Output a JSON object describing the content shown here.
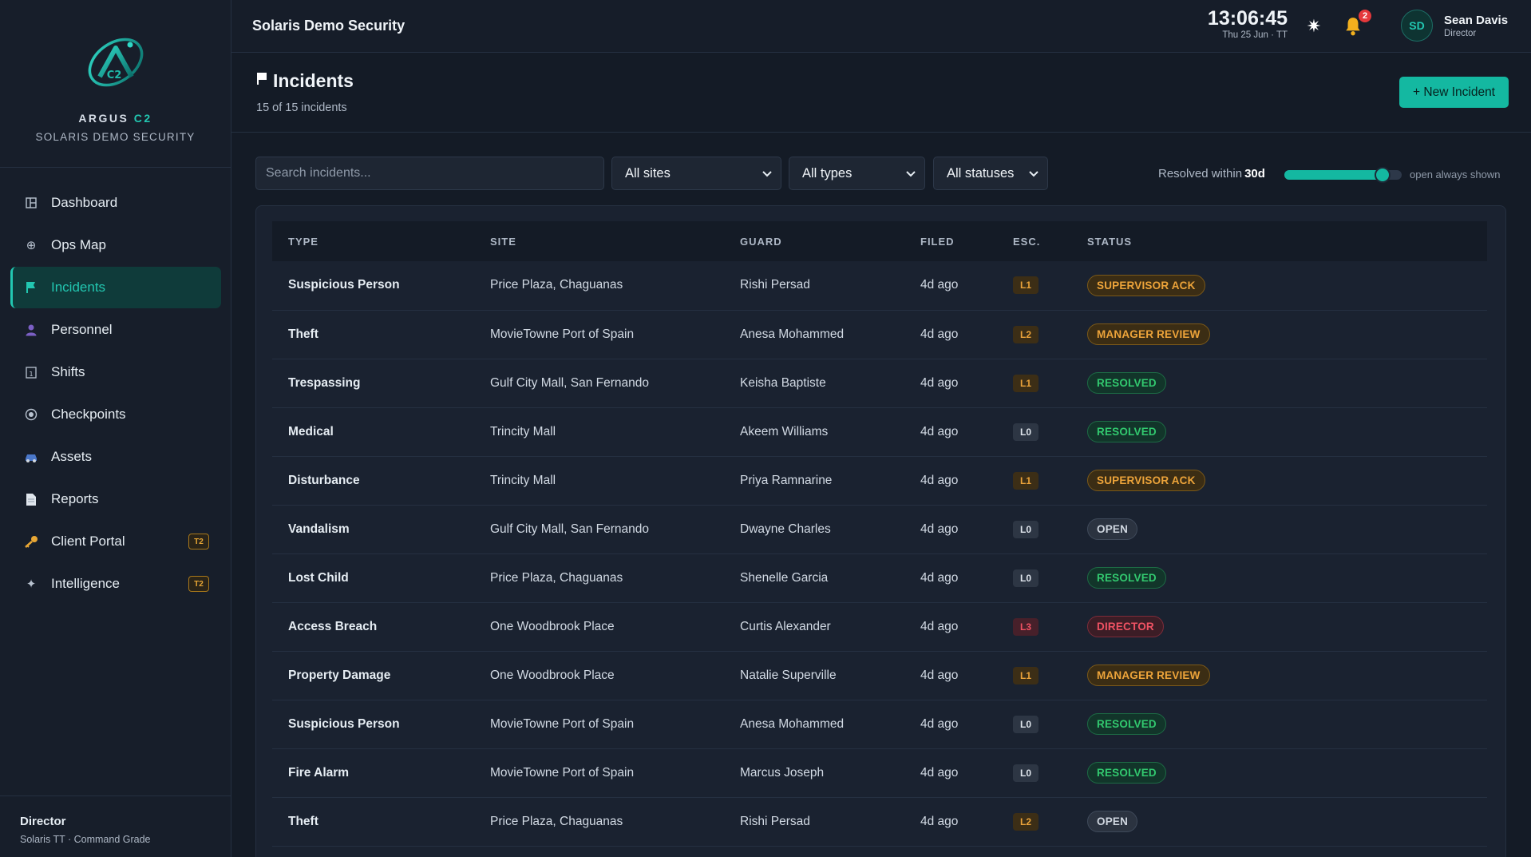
{
  "brand": {
    "name_prefix": "ARGUS ",
    "name_suffix": "C2",
    "org": "SOLARIS DEMO SECURITY",
    "logo_icon": "argus-c2-logo"
  },
  "sidebar": {
    "items": [
      {
        "label": "Dashboard",
        "icon": "dashboard-icon",
        "active": false
      },
      {
        "label": "Ops Map",
        "icon": "globe-icon",
        "active": false
      },
      {
        "label": "Incidents",
        "icon": "flag-icon",
        "active": true
      },
      {
        "label": "Personnel",
        "icon": "person-icon",
        "active": false
      },
      {
        "label": "Shifts",
        "icon": "calendar-icon",
        "active": false
      },
      {
        "label": "Checkpoints",
        "icon": "target-icon",
        "active": false
      },
      {
        "label": "Assets",
        "icon": "car-icon",
        "active": false
      },
      {
        "label": "Reports",
        "icon": "document-icon",
        "active": false
      },
      {
        "label": "Client Portal",
        "icon": "key-icon",
        "active": false,
        "tier": "T2"
      },
      {
        "label": "Intelligence",
        "icon": "sparkle-icon",
        "active": false,
        "tier": "T2"
      }
    ],
    "footer": {
      "role": "Director",
      "org": "Solaris TT · Command Grade"
    }
  },
  "topbar": {
    "title": "Solaris Demo Security",
    "time": "13:06:45",
    "date": "Thu 25 Jun · TT",
    "notifications_count": "2",
    "user": {
      "initials": "SD",
      "name": "Sean Davis",
      "role": "Director"
    }
  },
  "page": {
    "title": "Incidents",
    "count_text": "15 of 15 incidents",
    "new_button": "+ New Incident"
  },
  "filters": {
    "search_placeholder": "Search incidents...",
    "site": "All sites",
    "type": "All types",
    "status": "All statuses",
    "range_label": "Resolved within",
    "range_value": "30d",
    "range_fraction": 0.84,
    "range_note": "open always shown"
  },
  "table": {
    "columns": [
      "TYPE",
      "SITE",
      "GUARD",
      "FILED",
      "ESC.",
      "STATUS"
    ],
    "rows": [
      {
        "type": "Suspicious Person",
        "site": "Price Plaza, Chaguanas",
        "guard": "Rishi Persad",
        "filed": "4d ago",
        "esc": "L1",
        "status": "SUPERVISOR ACK"
      },
      {
        "type": "Theft",
        "site": "MovieTowne Port of Spain",
        "guard": "Anesa Mohammed",
        "filed": "4d ago",
        "esc": "L2",
        "status": "MANAGER REVIEW"
      },
      {
        "type": "Trespassing",
        "site": "Gulf City Mall, San Fernando",
        "guard": "Keisha Baptiste",
        "filed": "4d ago",
        "esc": "L1",
        "status": "RESOLVED"
      },
      {
        "type": "Medical",
        "site": "Trincity Mall",
        "guard": "Akeem Williams",
        "filed": "4d ago",
        "esc": "L0",
        "status": "RESOLVED"
      },
      {
        "type": "Disturbance",
        "site": "Trincity Mall",
        "guard": "Priya Ramnarine",
        "filed": "4d ago",
        "esc": "L1",
        "status": "SUPERVISOR ACK"
      },
      {
        "type": "Vandalism",
        "site": "Gulf City Mall, San Fernando",
        "guard": "Dwayne Charles",
        "filed": "4d ago",
        "esc": "L0",
        "status": "OPEN"
      },
      {
        "type": "Lost Child",
        "site": "Price Plaza, Chaguanas",
        "guard": "Shenelle Garcia",
        "filed": "4d ago",
        "esc": "L0",
        "status": "RESOLVED"
      },
      {
        "type": "Access Breach",
        "site": "One Woodbrook Place",
        "guard": "Curtis Alexander",
        "filed": "4d ago",
        "esc": "L3",
        "status": "DIRECTOR"
      },
      {
        "type": "Property Damage",
        "site": "One Woodbrook Place",
        "guard": "Natalie Superville",
        "filed": "4d ago",
        "esc": "L1",
        "status": "MANAGER REVIEW"
      },
      {
        "type": "Suspicious Person",
        "site": "MovieTowne Port of Spain",
        "guard": "Anesa Mohammed",
        "filed": "4d ago",
        "esc": "L0",
        "status": "RESOLVED"
      },
      {
        "type": "Fire Alarm",
        "site": "MovieTowne Port of Spain",
        "guard": "Marcus Joseph",
        "filed": "4d ago",
        "esc": "L0",
        "status": "RESOLVED"
      },
      {
        "type": "Theft",
        "site": "Price Plaza, Chaguanas",
        "guard": "Rishi Persad",
        "filed": "4d ago",
        "esc": "L2",
        "status": "OPEN"
      }
    ]
  },
  "colors": {
    "accent": "#14b8a1",
    "amber": "#eda43a",
    "green": "#32c96f",
    "red": "#f05263",
    "background": "#141b26"
  }
}
